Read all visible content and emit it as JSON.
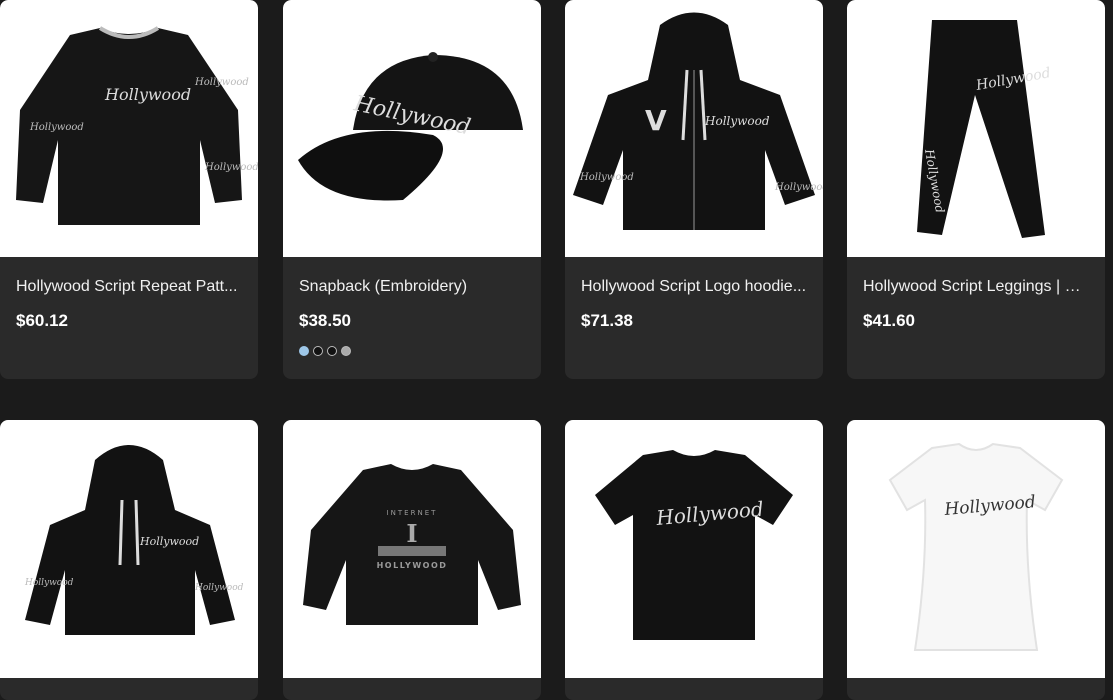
{
  "products": [
    {
      "title": "Hollywood Script Repeat Patt...",
      "price": "$60.12",
      "image": "black long-sleeve shirt with Hollywood script print"
    },
    {
      "title": "Snapback (Embroidery)",
      "price": "$38.50",
      "image": "black snapback cap with Hollywood embroidery",
      "swatches": [
        {
          "color": "#9ec7e8",
          "selected": true
        },
        {
          "color": "#111111",
          "selected": false
        },
        {
          "color": "#111111",
          "selected": false
        },
        {
          "color": "#aaaaaa",
          "selected": false
        }
      ]
    },
    {
      "title": "Hollywood Script Logo hoodie...",
      "price": "$71.38",
      "image": "black zip hoodie with Hollywood script logo"
    },
    {
      "title": "Hollywood Script Leggings | Bl...",
      "price": "$41.60",
      "image": "black leggings with Hollywood script"
    },
    {
      "image": "black pullover hoodie with Hollywood script"
    },
    {
      "image": "black long-sleeve shirt Internet Hollywood"
    },
    {
      "image": "black t-shirt with Hollywood script"
    },
    {
      "image": "white women's t-shirt with Hollywood script"
    }
  ],
  "colors": {
    "background": "#1b1b1b",
    "card": "#2a2a2a",
    "garment": "#121212"
  }
}
